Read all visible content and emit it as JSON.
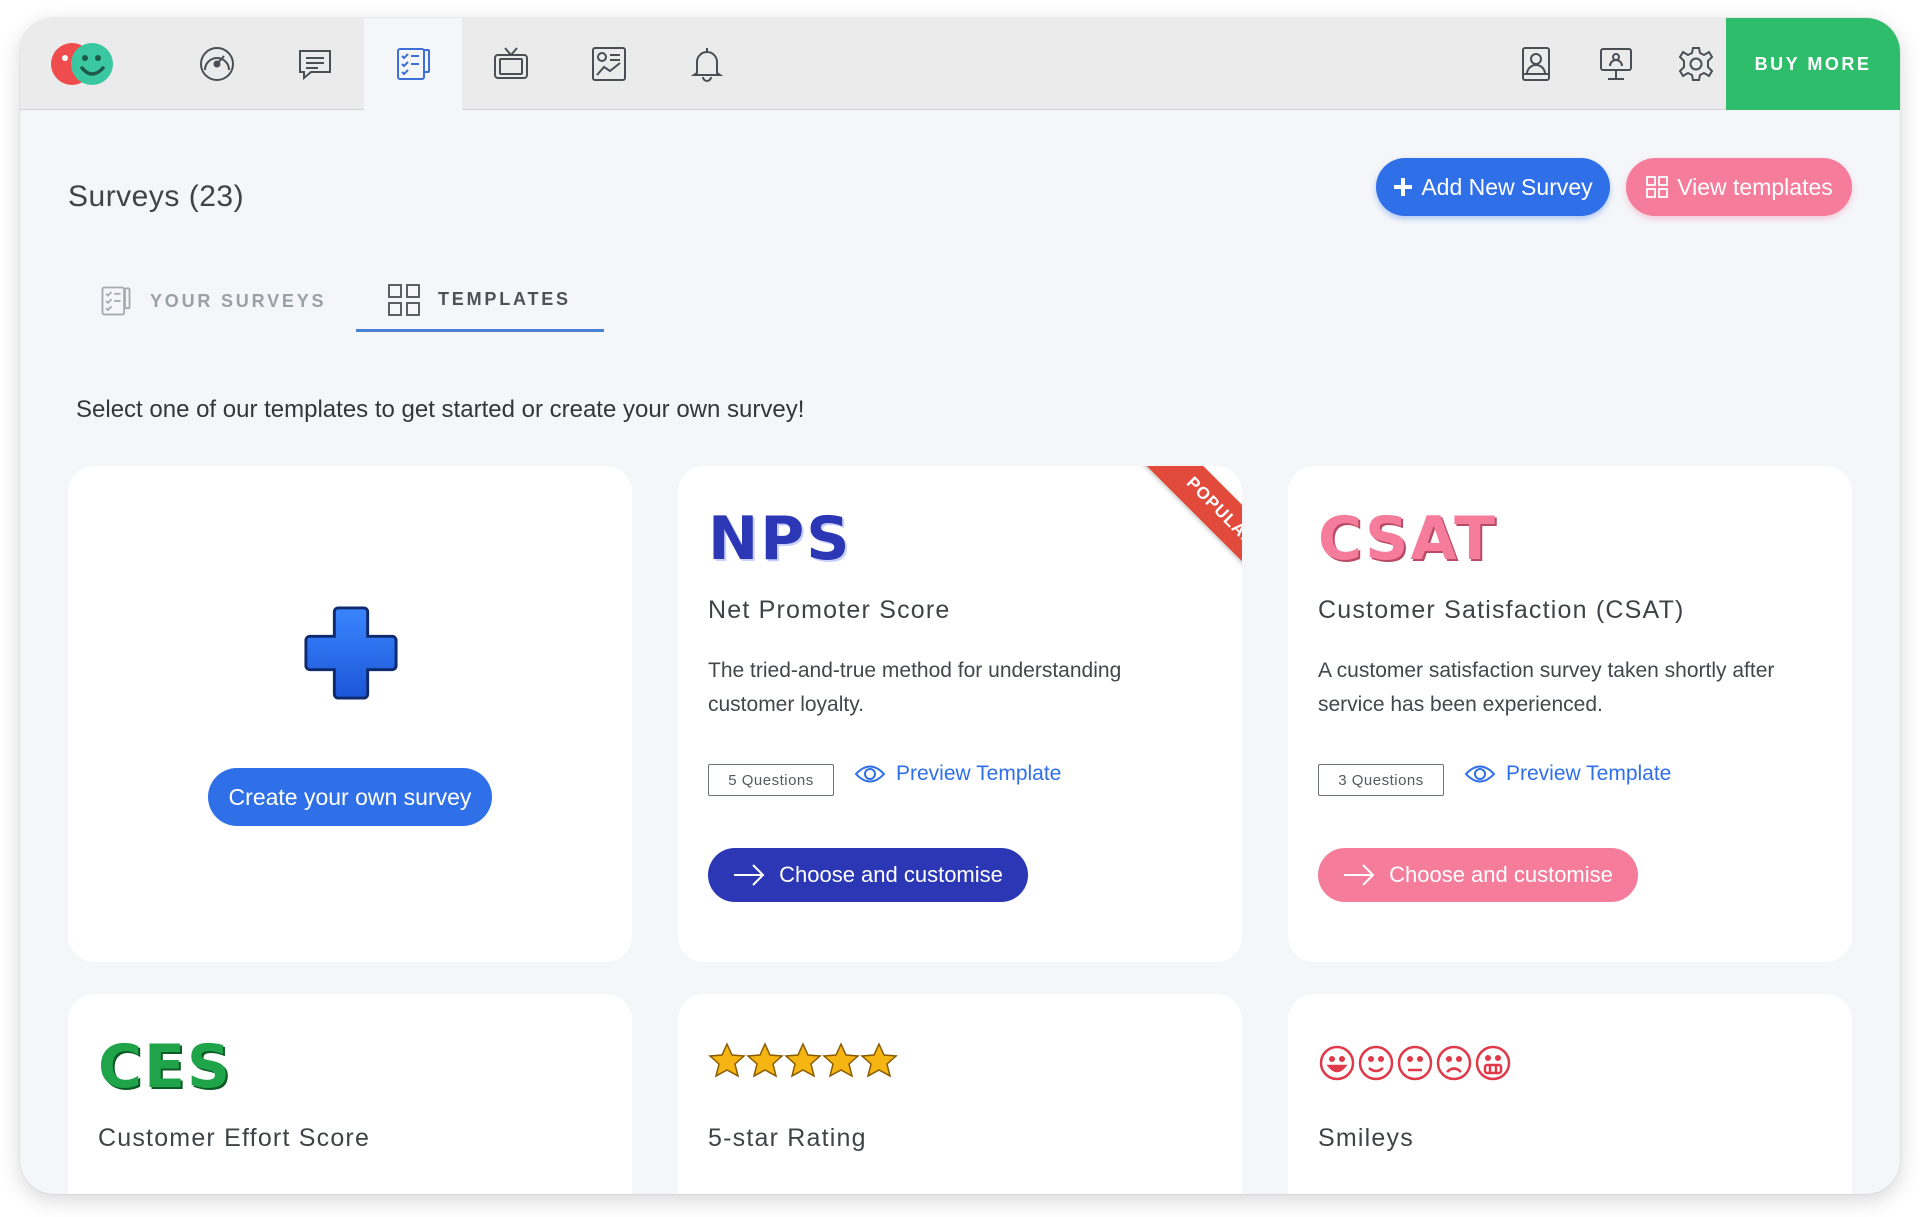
{
  "nav": {
    "items": [
      {
        "name": "dashboard-gauge-icon",
        "active": false
      },
      {
        "name": "feedback-chat-icon",
        "active": false
      },
      {
        "name": "surveys-checklist-icon",
        "active": true
      },
      {
        "name": "tv-display-icon",
        "active": false
      },
      {
        "name": "reports-chart-icon",
        "active": false
      },
      {
        "name": "notifications-bell-icon",
        "active": false
      }
    ],
    "right_items": [
      "contacts-icon",
      "presentation-icon",
      "settings-gear-icon"
    ],
    "buy_more_label": "BUY MORE"
  },
  "header": {
    "title": "Surveys (23)",
    "add_survey_label": "Add New Survey",
    "view_templates_label": "View templates"
  },
  "tabs": {
    "your_surveys": "YOUR SURVEYS",
    "templates": "TEMPLATES",
    "active": "templates"
  },
  "intro": "Select one of our templates to get started or create your own survey!",
  "create_card": {
    "button_label": "Create your own survey"
  },
  "templates": [
    {
      "logo": "NPS",
      "title": "Net Promoter Score",
      "description": "The tried-and-true method for understanding customer loyalty.",
      "questions": "5 Questions",
      "preview_label": "Preview Template",
      "choose_label": "Choose and customise",
      "badge": "POPULAR",
      "accent": "#2b37b5"
    },
    {
      "logo": "CSAT",
      "title": "Customer Satisfaction (CSAT)",
      "description": "A customer satisfaction survey taken shortly after service has been experienced.",
      "questions": "3 Questions",
      "preview_label": "Preview Template",
      "choose_label": "Choose and customise",
      "accent": "#f57c9b"
    },
    {
      "logo": "CES",
      "title": "Customer Effort Score",
      "accent": "#1fa44a"
    },
    {
      "logo": "stars",
      "title": "5-star Rating",
      "accent": "#f5b614"
    },
    {
      "logo": "smileys",
      "title": "Smileys",
      "accent": "#e03a4a"
    }
  ],
  "colors": {
    "primary": "#2f6fe8",
    "pink": "#f57c9b",
    "green": "#2ebd6b",
    "nps_blue": "#2b37b5",
    "ribbon_red": "#e24a3c"
  }
}
